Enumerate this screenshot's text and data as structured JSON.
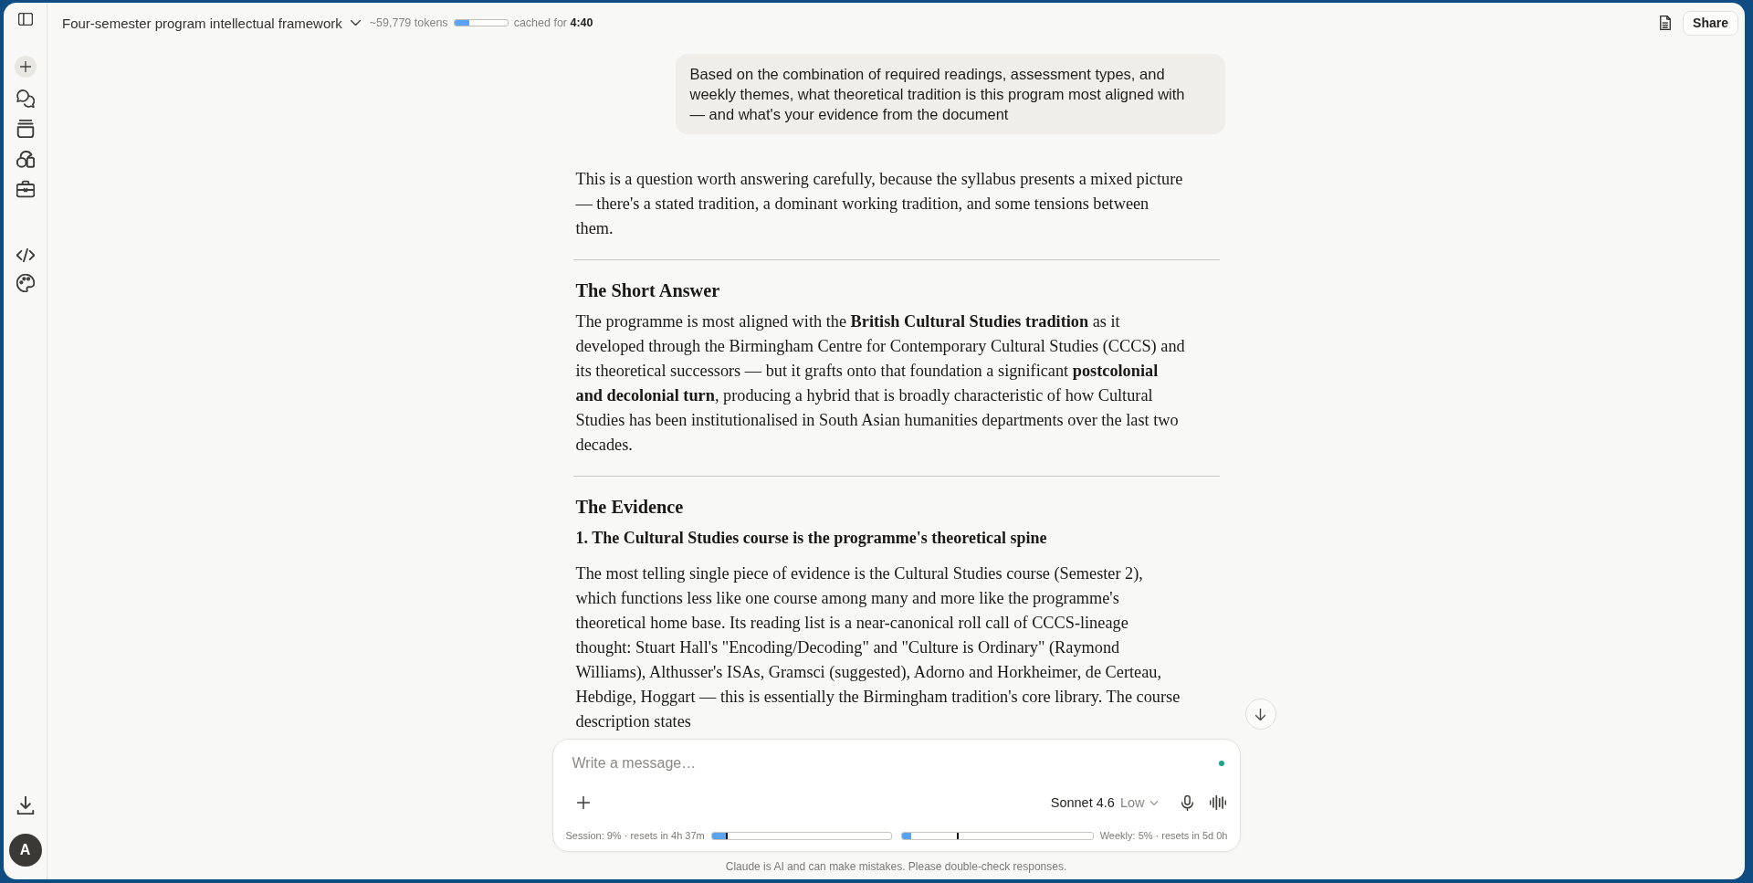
{
  "sidebar": {
    "avatar_initial": "A"
  },
  "header": {
    "title": "Four-semester program intellectual framework",
    "tokens": "~59,779 tokens",
    "context_usage": {
      "level": 0.29
    },
    "cache": "cached for **4:40**",
    "share": "Share"
  },
  "conversation": {
    "user_message": "Based on the combination of required readings, assessment types, and weekly themes, what theoretical tradition is this program most aligned with — and what's your evidence from the document",
    "response": [
      {
        "kind": "paragraph",
        "text": "This is a question worth answering carefully, because the syllabus presents a mixed picture — there's a stated tradition, a dominant working tradition, and some tensions between them."
      },
      {
        "kind": "divider"
      },
      {
        "kind": "heading",
        "text": "The Short Answer"
      },
      {
        "kind": "paragraph",
        "text": "The programme is most aligned with the **British Cultural Studies tradition** as it developed through the Birmingham Centre for Contemporary Cultural Studies (CCCS) and its theoretical successors — but it grafts onto that foundation a significant **postcolonial and decolonial turn**, producing a hybrid that is broadly characteristic of how Cultural Studies has been institutionalised in South Asian humanities departments over the last two decades."
      },
      {
        "kind": "divider"
      },
      {
        "kind": "heading",
        "text": "The Evidence"
      },
      {
        "kind": "subheading",
        "text": "1. The Cultural Studies course is the programme's theoretical spine"
      },
      {
        "kind": "paragraph",
        "text": "The most telling single piece of evidence is the Cultural Studies course (Semester 2), which functions less like one course among many and more like the programme's theoretical home base. Its reading list is a near-canonical roll call of CCCS-lineage thought: Stuart Hall's \"Encoding/Decoding\" and \"Culture is Ordinary\" (Raymond Williams), Althusser's ISAs, Gramsci (suggested), Adorno and Horkheimer, de Certeau, Hebdige, Hoggart — this is essentially the Birmingham tradition's core library. The course description states"
      }
    ]
  },
  "composer": {
    "placeholder": "Write a message…",
    "model": "Sonnet 4.6",
    "effort": "Low",
    "usage": [
      {
        "label": "Session: 9% · resets in 4h 37m",
        "level": 0.08,
        "marker": {
          "level": 0.085
        }
      },
      {
        "label": "Weekly: 5% · resets in 5d 0h",
        "level": 0.05,
        "marker": {
          "level": 0.29
        }
      }
    ]
  },
  "disclaimer": "Claude is AI and can make mistakes. Please double-check responses."
}
